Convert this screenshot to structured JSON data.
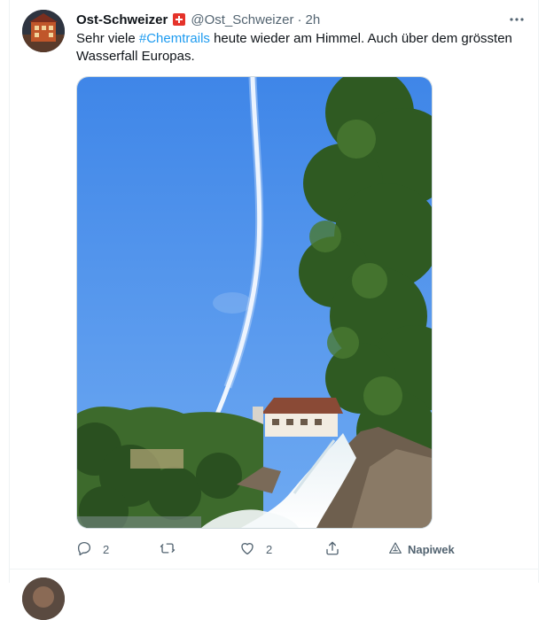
{
  "tweet": {
    "display_name": "Ost-Schweizer",
    "handle": "@Ost_Schweizer",
    "separator": "·",
    "time": "2h",
    "text_before": "Sehr viele ",
    "hashtag": "#Chemtrails",
    "text_after": " heute wieder am Himmel. Auch über dem grössten Wasserfall Europas."
  },
  "actions": {
    "reply_count": "2",
    "like_count": "2",
    "tip_label": "Napiwek"
  },
  "icons": {
    "flag": "swiss-flag-icon",
    "more": "more-icon",
    "reply": "reply-icon",
    "retweet": "retweet-icon",
    "like": "heart-icon",
    "share": "share-icon",
    "tip": "tip-icon"
  },
  "colors": {
    "accent": "#1d9bf0",
    "secondary_text": "#536471",
    "flag_red": "#e5332a"
  }
}
